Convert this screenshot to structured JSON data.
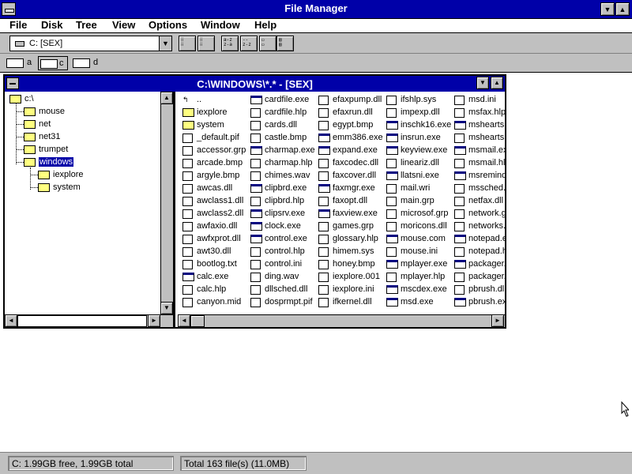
{
  "window": {
    "title": "File Manager"
  },
  "menu": {
    "items": [
      "File",
      "Disk",
      "Tree",
      "View",
      "Options",
      "Window",
      "Help"
    ]
  },
  "toolbar": {
    "drive_selector": "C: [SEX]"
  },
  "drives": [
    {
      "letter": "a"
    },
    {
      "letter": "c"
    },
    {
      "letter": "d"
    }
  ],
  "child_window": {
    "title": "C:\\WINDOWS\\*.* - [SEX]"
  },
  "tree": {
    "items": [
      {
        "label": "c:\\"
      },
      {
        "label": "mouse"
      },
      {
        "label": "net"
      },
      {
        "label": "net31"
      },
      {
        "label": "trumpet"
      },
      {
        "label": "windows"
      },
      {
        "label": "iexplore"
      },
      {
        "label": "system"
      }
    ]
  },
  "files": {
    "columns": [
      [
        {
          "name": "..",
          "type": "up"
        },
        {
          "name": "iexplore",
          "type": "dir"
        },
        {
          "name": "system",
          "type": "dir"
        },
        {
          "name": "_default.pif",
          "type": "doc"
        },
        {
          "name": "accessor.grp",
          "type": "doc"
        },
        {
          "name": "arcade.bmp",
          "type": "doc"
        },
        {
          "name": "argyle.bmp",
          "type": "doc"
        },
        {
          "name": "awcas.dll",
          "type": "doc"
        },
        {
          "name": "awclass1.dll",
          "type": "doc"
        },
        {
          "name": "awclass2.dll",
          "type": "doc"
        },
        {
          "name": "awfaxio.dll",
          "type": "doc"
        },
        {
          "name": "awfxprot.dll",
          "type": "doc"
        },
        {
          "name": "awt30.dll",
          "type": "doc"
        },
        {
          "name": "bootlog.txt",
          "type": "doc"
        },
        {
          "name": "calc.exe",
          "type": "exe"
        },
        {
          "name": "calc.hlp",
          "type": "doc"
        },
        {
          "name": "canyon.mid",
          "type": "doc"
        }
      ],
      [
        {
          "name": "cardfile.exe",
          "type": "exe"
        },
        {
          "name": "cardfile.hlp",
          "type": "doc"
        },
        {
          "name": "cards.dll",
          "type": "doc"
        },
        {
          "name": "castle.bmp",
          "type": "doc"
        },
        {
          "name": "charmap.exe",
          "type": "exe"
        },
        {
          "name": "charmap.hlp",
          "type": "doc"
        },
        {
          "name": "chimes.wav",
          "type": "doc"
        },
        {
          "name": "clipbrd.exe",
          "type": "exe"
        },
        {
          "name": "clipbrd.hlp",
          "type": "doc"
        },
        {
          "name": "clipsrv.exe",
          "type": "exe"
        },
        {
          "name": "clock.exe",
          "type": "exe"
        },
        {
          "name": "control.exe",
          "type": "exe"
        },
        {
          "name": "control.hlp",
          "type": "doc"
        },
        {
          "name": "control.ini",
          "type": "doc"
        },
        {
          "name": "ding.wav",
          "type": "doc"
        },
        {
          "name": "dllsched.dll",
          "type": "doc"
        },
        {
          "name": "dosprmpt.pif",
          "type": "doc"
        }
      ],
      [
        {
          "name": "efaxpump.dll",
          "type": "doc"
        },
        {
          "name": "efaxrun.dll",
          "type": "doc"
        },
        {
          "name": "egypt.bmp",
          "type": "doc"
        },
        {
          "name": "emm386.exe",
          "type": "exe"
        },
        {
          "name": "expand.exe",
          "type": "exe"
        },
        {
          "name": "faxcodec.dll",
          "type": "doc"
        },
        {
          "name": "faxcover.dll",
          "type": "doc"
        },
        {
          "name": "faxmgr.exe",
          "type": "exe"
        },
        {
          "name": "faxopt.dll",
          "type": "doc"
        },
        {
          "name": "faxview.exe",
          "type": "exe"
        },
        {
          "name": "games.grp",
          "type": "doc"
        },
        {
          "name": "glossary.hlp",
          "type": "doc"
        },
        {
          "name": "himem.sys",
          "type": "doc"
        },
        {
          "name": "honey.bmp",
          "type": "doc"
        },
        {
          "name": "iexplore.001",
          "type": "doc"
        },
        {
          "name": "iexplore.ini",
          "type": "doc"
        },
        {
          "name": "ifkernel.dll",
          "type": "doc"
        }
      ],
      [
        {
          "name": "ifshlp.sys",
          "type": "doc"
        },
        {
          "name": "impexp.dll",
          "type": "doc"
        },
        {
          "name": "inschk16.exe",
          "type": "exe"
        },
        {
          "name": "insrun.exe",
          "type": "exe"
        },
        {
          "name": "keyview.exe",
          "type": "exe"
        },
        {
          "name": "lineariz.dll",
          "type": "doc"
        },
        {
          "name": "llatsni.exe",
          "type": "exe"
        },
        {
          "name": "mail.wri",
          "type": "doc"
        },
        {
          "name": "main.grp",
          "type": "doc"
        },
        {
          "name": "microsof.grp",
          "type": "doc"
        },
        {
          "name": "moricons.dll",
          "type": "doc"
        },
        {
          "name": "mouse.com",
          "type": "exe"
        },
        {
          "name": "mouse.ini",
          "type": "doc"
        },
        {
          "name": "mplayer.exe",
          "type": "exe"
        },
        {
          "name": "mplayer.hlp",
          "type": "doc"
        },
        {
          "name": "mscdex.exe",
          "type": "exe"
        },
        {
          "name": "msd.exe",
          "type": "exe"
        }
      ],
      [
        {
          "name": "msd.ini",
          "type": "doc"
        },
        {
          "name": "msfax.hlp",
          "type": "doc"
        },
        {
          "name": "mshearts.e",
          "type": "exe"
        },
        {
          "name": "mshearts.h",
          "type": "doc"
        },
        {
          "name": "msmail.exe",
          "type": "exe"
        },
        {
          "name": "msmail.hlp",
          "type": "doc"
        },
        {
          "name": "msremind.e",
          "type": "exe"
        },
        {
          "name": "mssched.c",
          "type": "doc"
        },
        {
          "name": "netfax.dll",
          "type": "doc"
        },
        {
          "name": "network.gr",
          "type": "doc"
        },
        {
          "name": "networks.w",
          "type": "doc"
        },
        {
          "name": "notepad.ex",
          "type": "exe"
        },
        {
          "name": "notepad.hl",
          "type": "doc"
        },
        {
          "name": "packager.e",
          "type": "exe"
        },
        {
          "name": "packager.h",
          "type": "doc"
        },
        {
          "name": "pbrush.dll",
          "type": "doc"
        },
        {
          "name": "pbrush.exe",
          "type": "exe"
        }
      ]
    ]
  },
  "status": {
    "left": "C: 1.99GB free,  1.99GB total",
    "right": "Total 163 file(s) (11.0MB)"
  }
}
